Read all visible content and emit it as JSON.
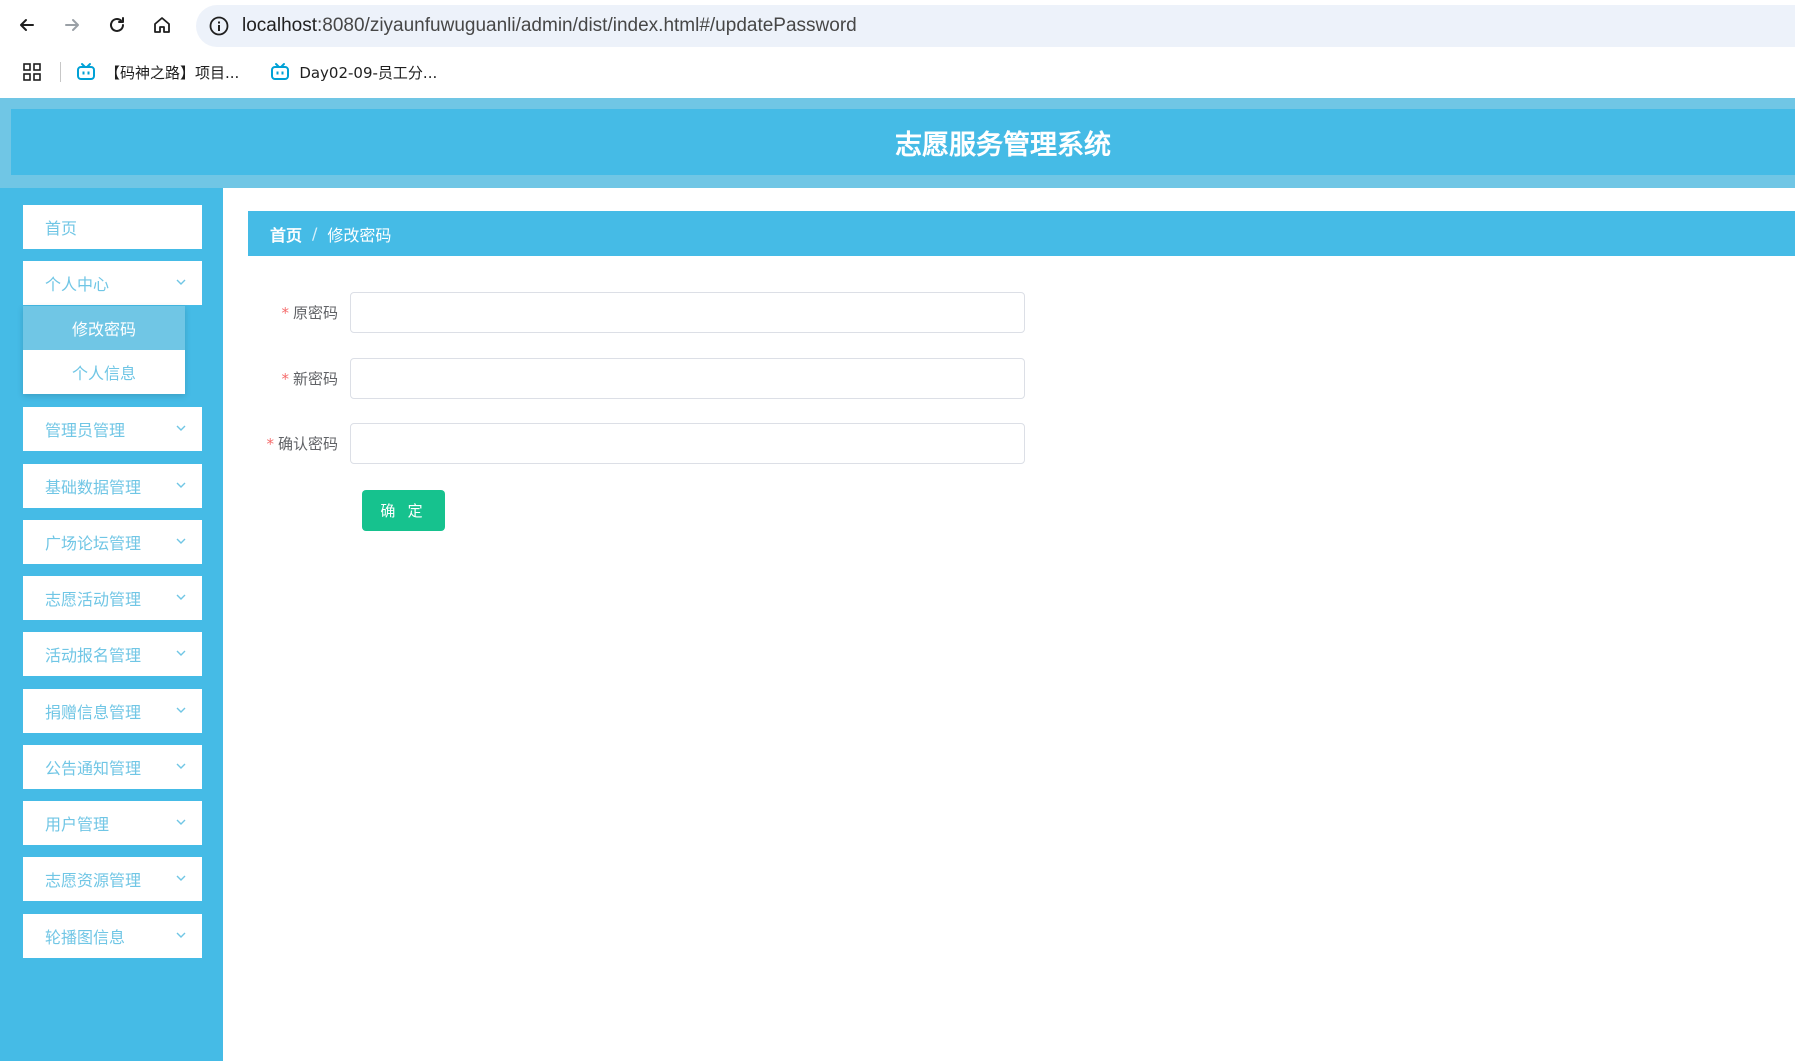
{
  "browser": {
    "url_host": "localhost",
    "url_rest": ":8080/ziyaunfuwuguanli/admin/dist/index.html#/updatePassword",
    "bookmarks": [
      {
        "label": "【码神之路】项目..."
      },
      {
        "label": "Day02-09-员工分..."
      }
    ]
  },
  "app": {
    "title": "志愿服务管理系统"
  },
  "sidebar": {
    "items": [
      {
        "label": "首页"
      },
      {
        "label": "个人中心"
      },
      {
        "label": "管理员管理"
      },
      {
        "label": "基础数据管理"
      },
      {
        "label": "广场论坛管理"
      },
      {
        "label": "志愿活动管理"
      },
      {
        "label": "活动报名管理"
      },
      {
        "label": "捐赠信息管理"
      },
      {
        "label": "公告通知管理"
      },
      {
        "label": "用户管理"
      },
      {
        "label": "志愿资源管理"
      },
      {
        "label": "轮播图信息"
      }
    ],
    "submenu": [
      {
        "label": "修改密码",
        "active": true
      },
      {
        "label": "个人信息",
        "active": false
      }
    ]
  },
  "breadcrumb": {
    "home": "首页",
    "separator": "/",
    "current": "修改密码"
  },
  "form": {
    "required_mark": "*",
    "old_password_label": "原密码",
    "new_password_label": "新密码",
    "confirm_password_label": "确认密码",
    "old_password_value": "",
    "new_password_value": "",
    "confirm_password_value": "",
    "submit_label": "确 定"
  },
  "colors": {
    "primary": "#45bbe6",
    "primary_light": "#70c6e5",
    "submit": "#16c28e",
    "required": "#f56c6c"
  }
}
